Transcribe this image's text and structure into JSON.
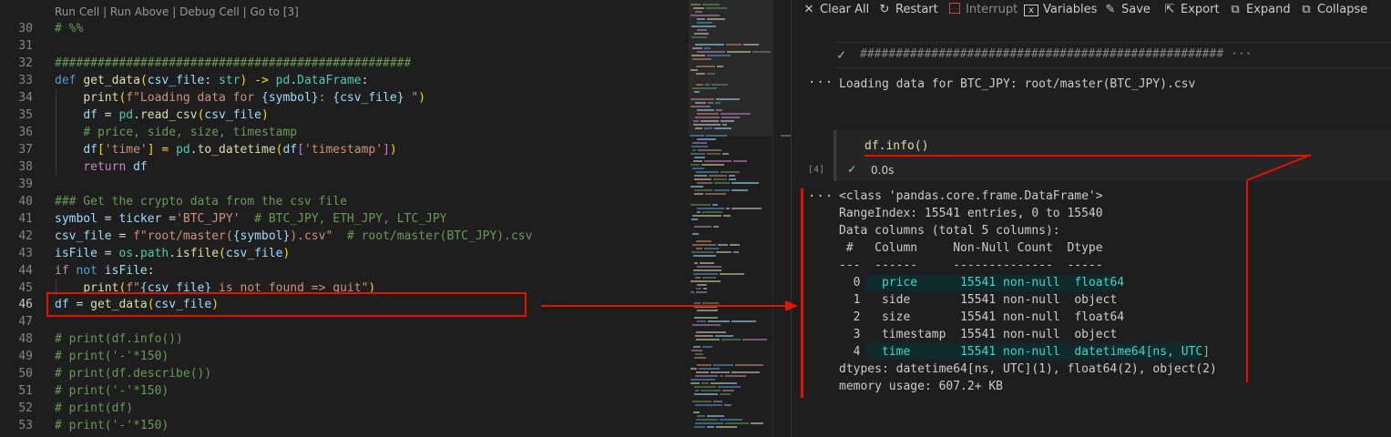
{
  "editor": {
    "codelens": "Run Cell | Run Above | Debug Cell | Go to [3]",
    "line_numbers": [
      "30",
      "31",
      "32",
      "33",
      "34",
      "35",
      "36",
      "37",
      "38",
      "39",
      "40",
      "41",
      "42",
      "43",
      "44",
      "45",
      "46",
      "47",
      "48",
      "49",
      "50",
      "51",
      "52",
      "53"
    ],
    "lines": {
      "l30": "# %%",
      "l32": "##################################################",
      "l33_a": "def",
      "l33_b": "get_data",
      "l33_c": "(",
      "l33_d": "csv_file",
      "l33_e": ": ",
      "l33_f": "str",
      "l33_g": ") -> ",
      "l33_h": "pd",
      "l33_i": ".",
      "l33_j": "DataFrame",
      "l33_k": ":",
      "l34_a": "print",
      "l34_b": "(",
      "l34_c": "f\"Loading data for ",
      "l34_d": "{symbol}",
      "l34_e": ": ",
      "l34_f": "{csv_file}",
      "l34_g": " \"",
      "l34_h": ")",
      "l35_a": "df",
      "l35_b": " = ",
      "l35_c": "pd",
      "l35_d": ".",
      "l35_e": "read_csv",
      "l35_f": "(",
      "l35_g": "csv_file",
      "l35_h": ")",
      "l36": "# price, side, size, timestamp",
      "l37_a": "df",
      "l37_b": "[",
      "l37_c": "'time'",
      "l37_d": "] = ",
      "l37_e": "pd",
      "l37_f": ".",
      "l37_g": "to_datetime",
      "l37_h": "(",
      "l37_i": "df",
      "l37_j": "[",
      "l37_k": "'timestamp'",
      "l37_l": "]",
      "l37_m": ")",
      "l38_a": "return",
      "l38_b": " df",
      "l40": "### Get the crypto data from the csv file",
      "l41_a": "symbol",
      "l41_b": " = ",
      "l41_c": "ticker",
      "l41_d": " =",
      "l41_e": "'BTC_JPY'",
      "l41_f": "  # BTC_JPY, ETH_JPY, LTC_JPY",
      "l42_a": "csv_file",
      "l42_b": " = ",
      "l42_c": "f\"root/master(",
      "l42_d": "{symbol}",
      "l42_e": ").csv\"",
      "l42_f": "  # root/master(BTC_JPY).csv",
      "l43_a": "isFile",
      "l43_b": " = ",
      "l43_c": "os",
      "l43_d": ".",
      "l43_e": "path",
      "l43_f": ".",
      "l43_g": "isfile",
      "l43_h": "(",
      "l43_i": "csv_file",
      "l43_j": ")",
      "l44_a": "if",
      "l44_b": " not ",
      "l44_c": "isFile",
      "l44_d": ":",
      "l45_a": "print",
      "l45_b": "(",
      "l45_c": "f\"",
      "l45_d": "{csv_file}",
      "l45_e": " is not found => quit\"",
      "l45_f": ")",
      "l46_a": "df",
      "l46_b": " = ",
      "l46_c": "get_data",
      "l46_d": "(",
      "l46_e": "csv_file",
      "l46_f": ")",
      "l48": "# print(df.info())",
      "l49": "# print('-'*150)",
      "l50": "# print(df.describe())",
      "l51": "# print('-'*150)",
      "l52": "# print(df)",
      "l53": "# print('-'*150)"
    }
  },
  "toolbar": {
    "clear_all": "Clear All",
    "restart": "Restart",
    "interrupt": "Interrupt",
    "variables": "Variables",
    "save": "Save",
    "export": "Export",
    "expand": "Expand",
    "collapse": "Collapse"
  },
  "interactive": {
    "collapsed_cell": "################################################### ···",
    "output_1": "Loading data for BTC_JPY: root/master(BTC_JPY).csv",
    "cell_code": "df.info()",
    "exec_count": "[4]",
    "exec_time": "0.0s",
    "info_output": {
      "class_line": "<class 'pandas.core.frame.DataFrame'>",
      "range_index": "RangeIndex: 15541 entries, 0 to 15540",
      "data_columns": "Data columns (total 5 columns):",
      "header": " #   Column     Non-Null Count  Dtype",
      "separator": "---  ------     --------------  -----",
      "rows": [
        {
          "idx": "0",
          "column": "price",
          "count": "15541 non-null",
          "dtype": "float64"
        },
        {
          "idx": "1",
          "column": "side",
          "count": "15541 non-null",
          "dtype": "object"
        },
        {
          "idx": "2",
          "column": "size",
          "count": "15541 non-null",
          "dtype": "float64"
        },
        {
          "idx": "3",
          "column": "timestamp",
          "count": "15541 non-null",
          "dtype": "object"
        },
        {
          "idx": "4",
          "column": "time",
          "count": "15541 non-null",
          "dtype": "datetime64[ns, UTC]"
        }
      ],
      "dtypes": "dtypes: datetime64[ns, UTC](1), float64(2), object(2)",
      "memory": "memory usage: 607.2+ KB"
    }
  },
  "colors": {
    "annotation": "#e51400",
    "keyword": "#569cd6",
    "function": "#dcdcaa",
    "string": "#ce9178",
    "comment": "#6a9955",
    "highlight_text": "#3dd6c6"
  },
  "icons": [
    "close-icon",
    "restart-icon",
    "interrupt-icon",
    "variables-icon",
    "save-icon",
    "export-icon",
    "expand-icon",
    "collapse-icon",
    "check-icon",
    "ellipsis-icon"
  ]
}
